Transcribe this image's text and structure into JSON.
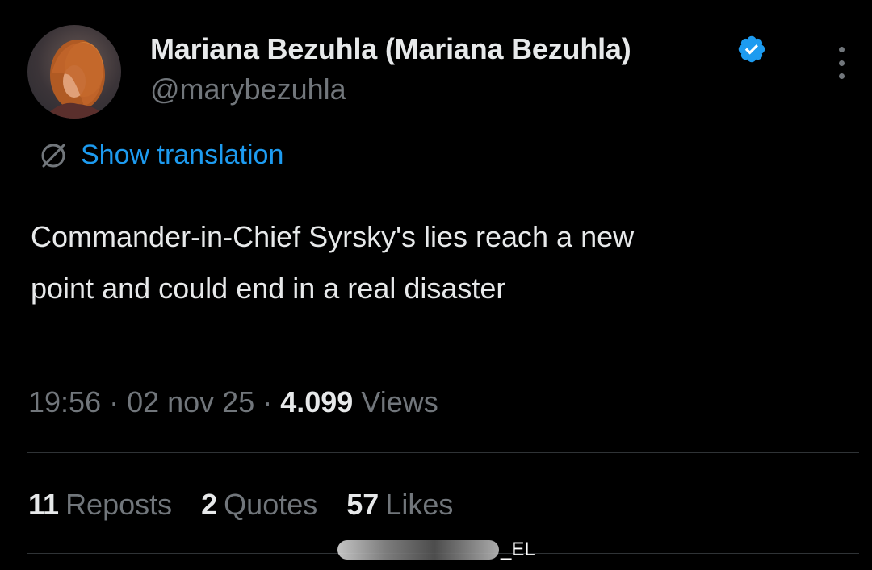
{
  "author": {
    "name": "Mariana Bezuhla (Mariana Bezuhla)",
    "handle": "@marybezuhla",
    "verified_icon": "verified-badge-icon",
    "avatar_icon": "profile-photo"
  },
  "translation": {
    "label": "Show translation",
    "icon": "globe-translate-icon"
  },
  "tweet": {
    "line1": "Commander-in-Chief Syrsky's lies reach a new",
    "line2": "point and could end in a real disaster"
  },
  "meta": {
    "time": "19:56",
    "sep1": " · ",
    "date": "02 nov 25",
    "sep2": " · ",
    "views_count": "4.099",
    "views_label": " Views"
  },
  "stats": {
    "reposts_count": "11",
    "reposts_label": "Reposts",
    "quotes_count": "2",
    "quotes_label": "Quotes",
    "likes_count": "57",
    "likes_label": "Likes"
  },
  "watermark": {
    "text": "_EL"
  },
  "colors": {
    "background": "#000000",
    "primary_text": "#e7e9ea",
    "secondary_text": "#71767b",
    "accent": "#1d9bf0",
    "divider": "#2f3336"
  }
}
